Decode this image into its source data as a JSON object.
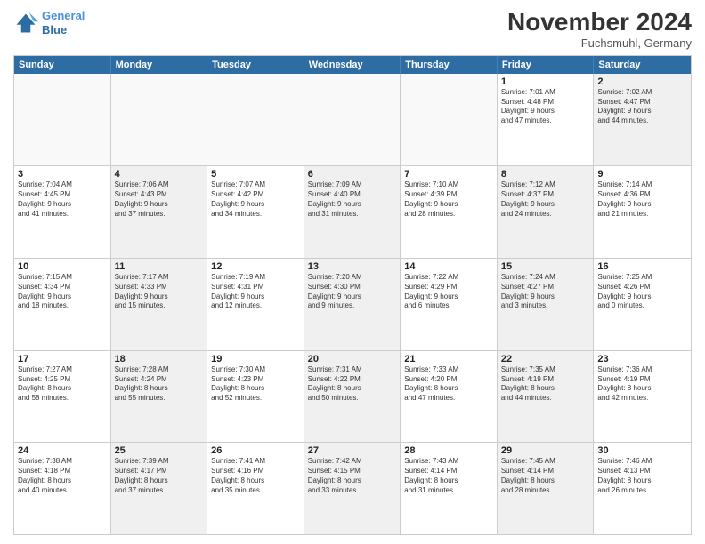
{
  "header": {
    "logo_line1": "General",
    "logo_line2": "Blue",
    "month_title": "November 2024",
    "subtitle": "Fuchsmuhl, Germany"
  },
  "weekdays": [
    "Sunday",
    "Monday",
    "Tuesday",
    "Wednesday",
    "Thursday",
    "Friday",
    "Saturday"
  ],
  "rows": [
    [
      {
        "day": "",
        "info": "",
        "empty": true
      },
      {
        "day": "",
        "info": "",
        "empty": true
      },
      {
        "day": "",
        "info": "",
        "empty": true
      },
      {
        "day": "",
        "info": "",
        "empty": true
      },
      {
        "day": "",
        "info": "",
        "empty": true
      },
      {
        "day": "1",
        "info": "Sunrise: 7:01 AM\nSunset: 4:48 PM\nDaylight: 9 hours\nand 47 minutes.",
        "empty": false,
        "shaded": false
      },
      {
        "day": "2",
        "info": "Sunrise: 7:02 AM\nSunset: 4:47 PM\nDaylight: 9 hours\nand 44 minutes.",
        "empty": false,
        "shaded": true
      }
    ],
    [
      {
        "day": "3",
        "info": "Sunrise: 7:04 AM\nSunset: 4:45 PM\nDaylight: 9 hours\nand 41 minutes.",
        "empty": false,
        "shaded": false
      },
      {
        "day": "4",
        "info": "Sunrise: 7:06 AM\nSunset: 4:43 PM\nDaylight: 9 hours\nand 37 minutes.",
        "empty": false,
        "shaded": true
      },
      {
        "day": "5",
        "info": "Sunrise: 7:07 AM\nSunset: 4:42 PM\nDaylight: 9 hours\nand 34 minutes.",
        "empty": false,
        "shaded": false
      },
      {
        "day": "6",
        "info": "Sunrise: 7:09 AM\nSunset: 4:40 PM\nDaylight: 9 hours\nand 31 minutes.",
        "empty": false,
        "shaded": true
      },
      {
        "day": "7",
        "info": "Sunrise: 7:10 AM\nSunset: 4:39 PM\nDaylight: 9 hours\nand 28 minutes.",
        "empty": false,
        "shaded": false
      },
      {
        "day": "8",
        "info": "Sunrise: 7:12 AM\nSunset: 4:37 PM\nDaylight: 9 hours\nand 24 minutes.",
        "empty": false,
        "shaded": true
      },
      {
        "day": "9",
        "info": "Sunrise: 7:14 AM\nSunset: 4:36 PM\nDaylight: 9 hours\nand 21 minutes.",
        "empty": false,
        "shaded": false
      }
    ],
    [
      {
        "day": "10",
        "info": "Sunrise: 7:15 AM\nSunset: 4:34 PM\nDaylight: 9 hours\nand 18 minutes.",
        "empty": false,
        "shaded": false
      },
      {
        "day": "11",
        "info": "Sunrise: 7:17 AM\nSunset: 4:33 PM\nDaylight: 9 hours\nand 15 minutes.",
        "empty": false,
        "shaded": true
      },
      {
        "day": "12",
        "info": "Sunrise: 7:19 AM\nSunset: 4:31 PM\nDaylight: 9 hours\nand 12 minutes.",
        "empty": false,
        "shaded": false
      },
      {
        "day": "13",
        "info": "Sunrise: 7:20 AM\nSunset: 4:30 PM\nDaylight: 9 hours\nand 9 minutes.",
        "empty": false,
        "shaded": true
      },
      {
        "day": "14",
        "info": "Sunrise: 7:22 AM\nSunset: 4:29 PM\nDaylight: 9 hours\nand 6 minutes.",
        "empty": false,
        "shaded": false
      },
      {
        "day": "15",
        "info": "Sunrise: 7:24 AM\nSunset: 4:27 PM\nDaylight: 9 hours\nand 3 minutes.",
        "empty": false,
        "shaded": true
      },
      {
        "day": "16",
        "info": "Sunrise: 7:25 AM\nSunset: 4:26 PM\nDaylight: 9 hours\nand 0 minutes.",
        "empty": false,
        "shaded": false
      }
    ],
    [
      {
        "day": "17",
        "info": "Sunrise: 7:27 AM\nSunset: 4:25 PM\nDaylight: 8 hours\nand 58 minutes.",
        "empty": false,
        "shaded": false
      },
      {
        "day": "18",
        "info": "Sunrise: 7:28 AM\nSunset: 4:24 PM\nDaylight: 8 hours\nand 55 minutes.",
        "empty": false,
        "shaded": true
      },
      {
        "day": "19",
        "info": "Sunrise: 7:30 AM\nSunset: 4:23 PM\nDaylight: 8 hours\nand 52 minutes.",
        "empty": false,
        "shaded": false
      },
      {
        "day": "20",
        "info": "Sunrise: 7:31 AM\nSunset: 4:22 PM\nDaylight: 8 hours\nand 50 minutes.",
        "empty": false,
        "shaded": true
      },
      {
        "day": "21",
        "info": "Sunrise: 7:33 AM\nSunset: 4:20 PM\nDaylight: 8 hours\nand 47 minutes.",
        "empty": false,
        "shaded": false
      },
      {
        "day": "22",
        "info": "Sunrise: 7:35 AM\nSunset: 4:19 PM\nDaylight: 8 hours\nand 44 minutes.",
        "empty": false,
        "shaded": true
      },
      {
        "day": "23",
        "info": "Sunrise: 7:36 AM\nSunset: 4:19 PM\nDaylight: 8 hours\nand 42 minutes.",
        "empty": false,
        "shaded": false
      }
    ],
    [
      {
        "day": "24",
        "info": "Sunrise: 7:38 AM\nSunset: 4:18 PM\nDaylight: 8 hours\nand 40 minutes.",
        "empty": false,
        "shaded": false
      },
      {
        "day": "25",
        "info": "Sunrise: 7:39 AM\nSunset: 4:17 PM\nDaylight: 8 hours\nand 37 minutes.",
        "empty": false,
        "shaded": true
      },
      {
        "day": "26",
        "info": "Sunrise: 7:41 AM\nSunset: 4:16 PM\nDaylight: 8 hours\nand 35 minutes.",
        "empty": false,
        "shaded": false
      },
      {
        "day": "27",
        "info": "Sunrise: 7:42 AM\nSunset: 4:15 PM\nDaylight: 8 hours\nand 33 minutes.",
        "empty": false,
        "shaded": true
      },
      {
        "day": "28",
        "info": "Sunrise: 7:43 AM\nSunset: 4:14 PM\nDaylight: 8 hours\nand 31 minutes.",
        "empty": false,
        "shaded": false
      },
      {
        "day": "29",
        "info": "Sunrise: 7:45 AM\nSunset: 4:14 PM\nDaylight: 8 hours\nand 28 minutes.",
        "empty": false,
        "shaded": true
      },
      {
        "day": "30",
        "info": "Sunrise: 7:46 AM\nSunset: 4:13 PM\nDaylight: 8 hours\nand 26 minutes.",
        "empty": false,
        "shaded": false
      }
    ]
  ]
}
